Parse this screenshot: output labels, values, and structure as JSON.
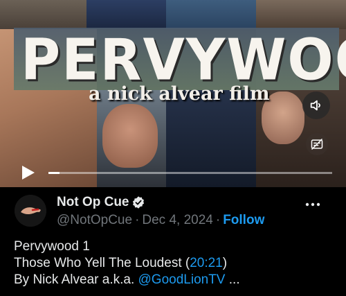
{
  "video": {
    "title_main": "PERVYWOOD",
    "title_sub": "a nick alvear film",
    "progress": 0.04,
    "volume_icon": "speaker-muted-icon",
    "captions_icon": "closed-captions-icon",
    "play_icon": "play-icon"
  },
  "author": {
    "name": "Not Op Cue",
    "handle": "@NotOpCue",
    "separator": "·",
    "date": "Dec 4, 2024",
    "follow_label": "Follow",
    "verified_icon": "verified-badge-icon",
    "more_icon": "more-dots-icon"
  },
  "tweet": {
    "line1": "Pervywood 1",
    "line2_prefix": "Those Who Yell The Loudest (",
    "line2_link": "20:21",
    "line2_suffix": ")",
    "line3_prefix": "By Nick Alvear a.k.a. ",
    "line3_mention": "@GoodLionTV",
    "line3_suffix": " ..."
  },
  "colors": {
    "background": "#000000",
    "text": "#e7e9ea",
    "muted": "#71767b",
    "accent": "#1d9bf0"
  }
}
